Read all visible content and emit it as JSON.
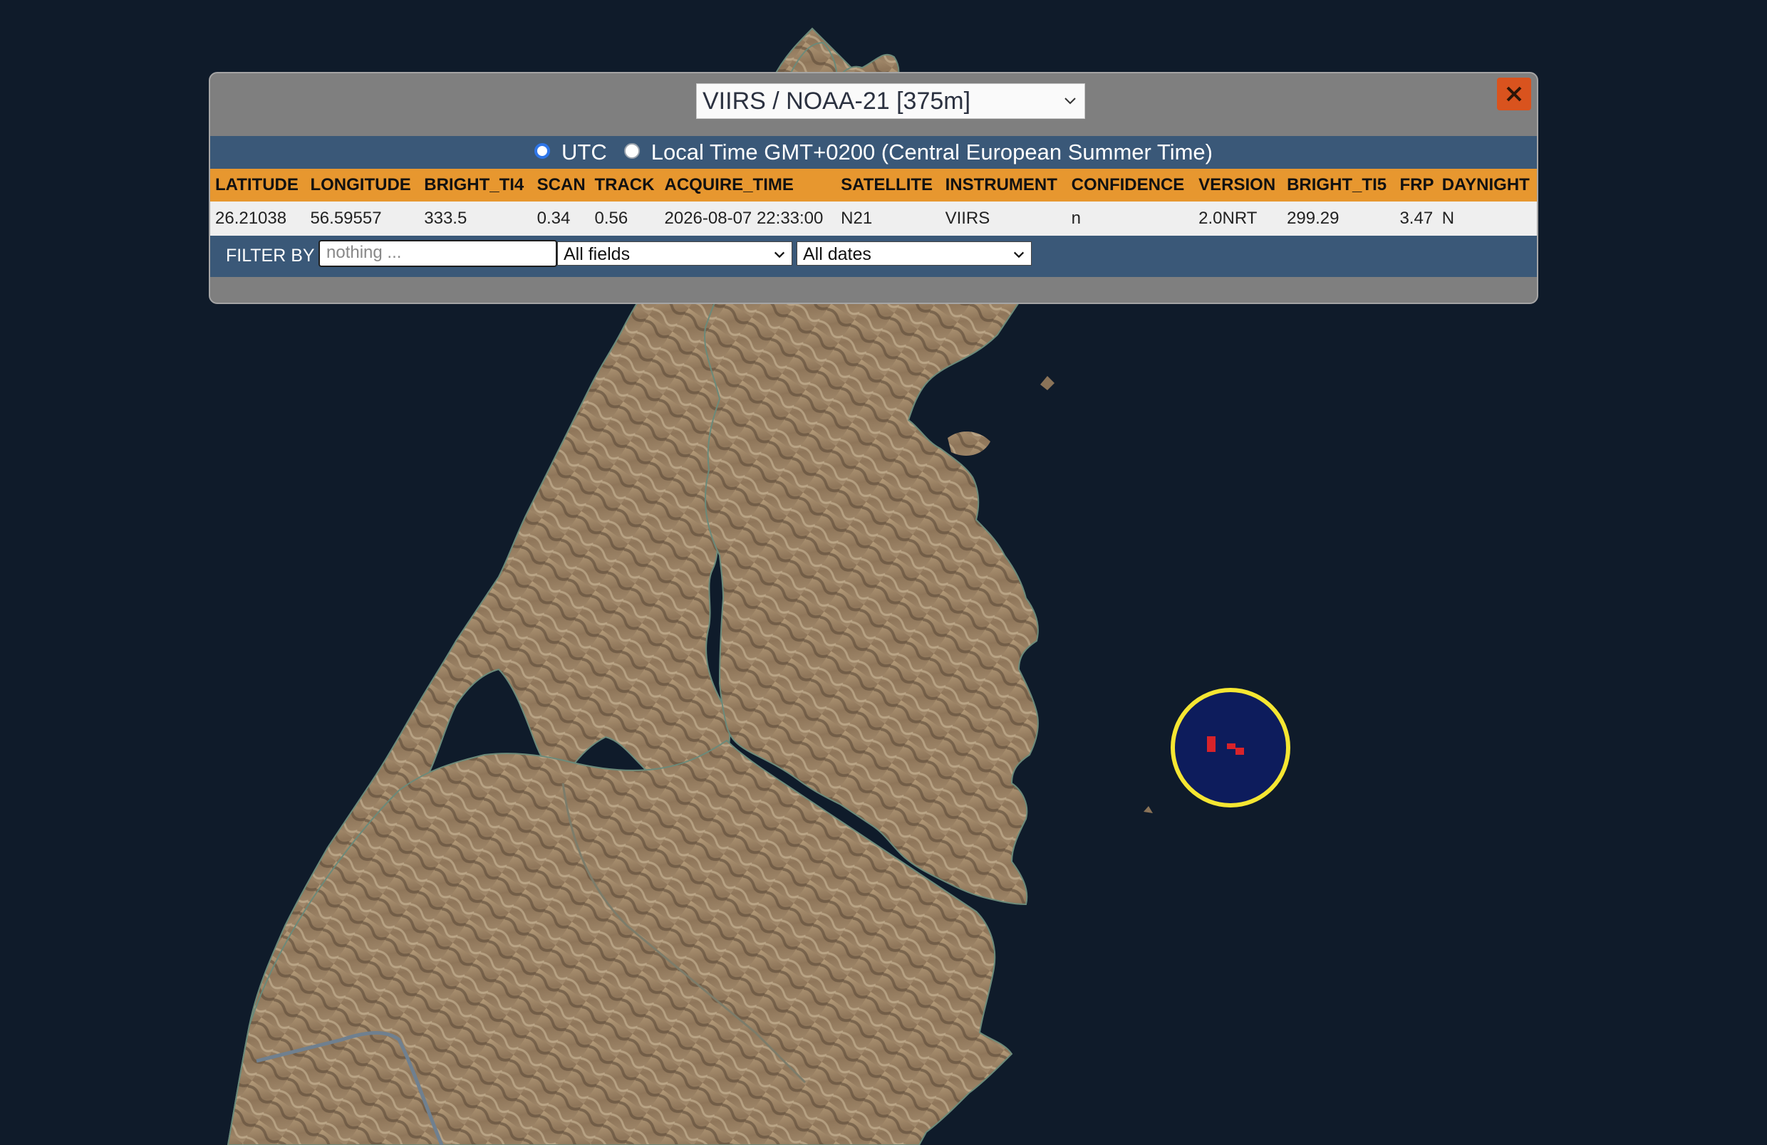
{
  "panel": {
    "source_label": "VIIRS / NOAA-21 [375m]",
    "close_label": "✕",
    "time_options": [
      "UTC",
      "Local Time GMT+0200 (Central European Summer Time)"
    ],
    "columns": [
      "LATITUDE",
      "LONGITUDE",
      "BRIGHT_TI4",
      "SCAN",
      "TRACK",
      "ACQUIRE_TIME",
      "SATELLITE",
      "INSTRUMENT",
      "CONFIDENCE",
      "VERSION",
      "BRIGHT_TI5",
      "FRP",
      "DAYNIGHT"
    ],
    "rows": [
      [
        "26.21038",
        "56.59557",
        "333.5",
        "0.34",
        "0.56",
        "2026-08-07 22:33:00",
        "N21",
        "VIIRS",
        "n",
        "2.0NRT",
        "299.29",
        "3.47",
        "N"
      ]
    ],
    "filter": {
      "label": "FILTER BY",
      "placeholder": "nothing ...",
      "field_value": "All fields",
      "date_value": "All dates"
    }
  },
  "map": {
    "icons": [
      "close-icon",
      "chevron-down-icon",
      "fire-marker-icon"
    ],
    "colors": {
      "water": "#0f1b2a",
      "land": "#a08667",
      "marker_ring": "#f5e632",
      "marker_fill": "#0d1c5c",
      "fire": "#d8232a"
    }
  }
}
